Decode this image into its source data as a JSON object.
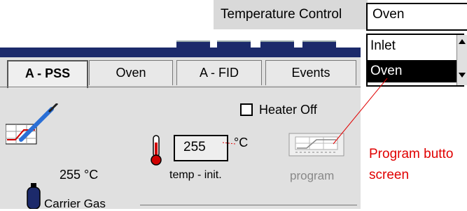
{
  "temperature_control": {
    "label": "Temperature Control",
    "selected": "Oven",
    "options": [
      "Inlet",
      "Oven"
    ]
  },
  "tabs": [
    "A - PSS",
    "Oven",
    "A - FID",
    "Events"
  ],
  "active_tab": "A - PSS",
  "heater": {
    "label": "Heater Off",
    "checked": false
  },
  "temperature": {
    "value": "255",
    "unit": "°C",
    "caption": "temp - init.",
    "readout": "255 °C"
  },
  "program": {
    "label": "program"
  },
  "carrier": {
    "label": "Carrier Gas"
  },
  "annotation": {
    "line1": "Program butto",
    "line2": "screen"
  },
  "colors": {
    "navy": "#1c2a6b",
    "annotation": "#e00000",
    "selected": "#000000"
  }
}
